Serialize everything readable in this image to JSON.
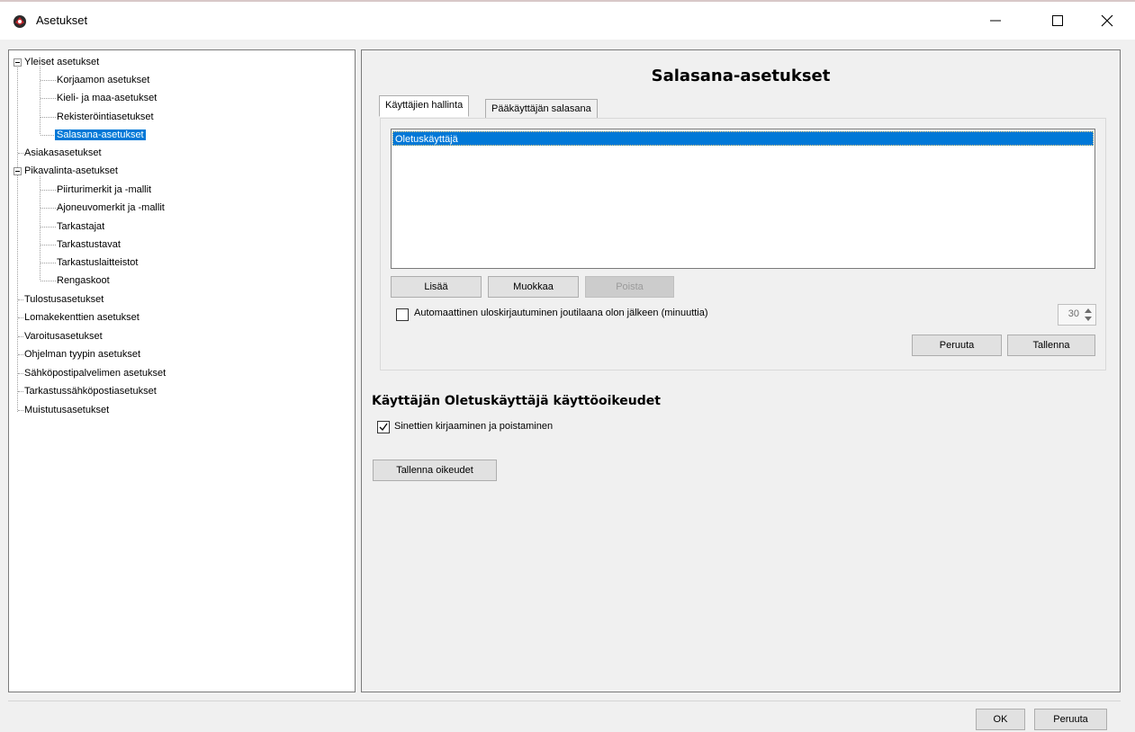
{
  "window": {
    "title": "Asetukset",
    "icon": "app-logo-icon",
    "controls": [
      "minimize-icon",
      "maximize-icon",
      "close-icon"
    ]
  },
  "tree": {
    "groups": [
      {
        "label": "Yleiset asetukset",
        "expanded": true,
        "children": [
          "Korjaamon asetukset",
          "Kieli- ja maa-asetukset",
          "Rekisteröintiasetukset",
          "Salasana-asetukset"
        ]
      },
      {
        "label": "Asiakasasetukset"
      },
      {
        "label": "Pikavalinta-asetukset",
        "expanded": true,
        "children": [
          "Piirturimerkit ja -mallit",
          "Ajoneuvomerkit ja -mallit",
          "Tarkastajat",
          "Tarkastustavat",
          "Tarkastuslaitteistot",
          "Rengaskoot"
        ]
      },
      {
        "label": "Tulostusasetukset"
      },
      {
        "label": "Lomakekenttien asetukset"
      },
      {
        "label": "Varoitusasetukset"
      },
      {
        "label": "Ohjelman tyypin asetukset"
      },
      {
        "label": "Sähköpostipalvelimen asetukset"
      },
      {
        "label": "Tarkastussähköpostiasetukset"
      },
      {
        "label": "Muistutusasetukset"
      }
    ],
    "selected": "Salasana-asetukset"
  },
  "main": {
    "title": "Salasana-asetukset",
    "tabs": [
      {
        "label": "Käyttäjien hallinta",
        "active": true
      },
      {
        "label": "Pääkäyttäjän salasana",
        "active": false
      }
    ],
    "users": [
      "Oletuskäyttäjä"
    ],
    "buttons": {
      "add": "Lisää",
      "edit": "Muokkaa",
      "delete": "Poista"
    },
    "auto_logout": {
      "label": "Automaattinen uloskirjautuminen joutilaana olon jälkeen (minuuttia)",
      "checked": false,
      "minutes": "30"
    },
    "tab_actions": {
      "cancel": "Peruuta",
      "save": "Tallenna"
    },
    "permissions": {
      "title": "Käyttäjän Oletuskäyttäjä käyttöoikeudet",
      "items": [
        {
          "label": "Sinettien kirjaaminen ja poistaminen",
          "checked": true
        }
      ],
      "save_button": "Tallenna oikeudet"
    }
  },
  "footer": {
    "ok": "OK",
    "cancel": "Peruuta"
  },
  "colors": {
    "selection": "#0078d7",
    "window_bg": "#f0f0f0",
    "button_bg": "#e1e1e1",
    "icon_red": "#b22222"
  }
}
